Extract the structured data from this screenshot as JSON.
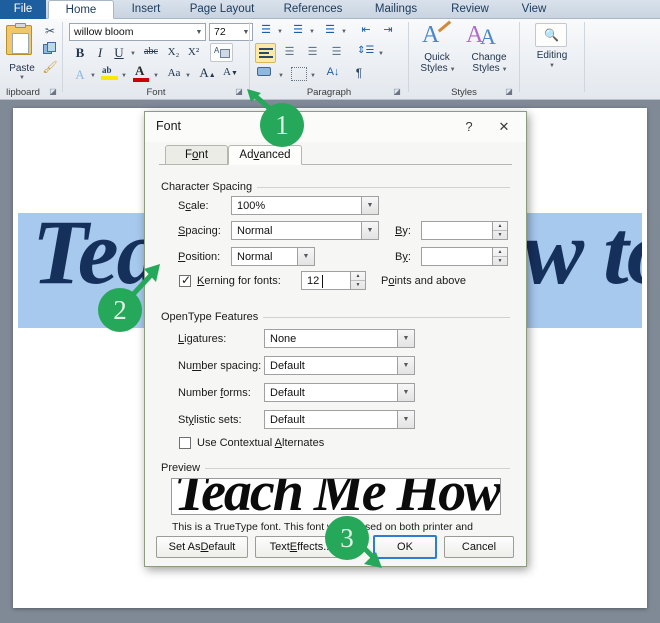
{
  "ribbon": {
    "tabs": [
      {
        "label": "File",
        "name": "tab-file"
      },
      {
        "label": "Home",
        "name": "tab-home"
      },
      {
        "label": "Insert",
        "name": "tab-insert"
      },
      {
        "label": "Page Layout",
        "name": "tab-page-layout"
      },
      {
        "label": "References",
        "name": "tab-references"
      },
      {
        "label": "Mailings",
        "name": "tab-mailings"
      },
      {
        "label": "Review",
        "name": "tab-review"
      },
      {
        "label": "View",
        "name": "tab-view"
      }
    ],
    "groups": {
      "clipboard": "lipboard",
      "font": "Font",
      "paragraph": "Paragraph",
      "styles": "Styles"
    },
    "paste_label": "Paste",
    "font_name": "willow bloom",
    "font_size": "72",
    "quick_styles": [
      "Quick",
      "Styles"
    ],
    "change_styles": [
      "Change",
      "Styles"
    ],
    "editing_label": "Editing",
    "buttons": {
      "bold": "B",
      "italic": "I",
      "underline": "U",
      "strike": "abc",
      "subscript": "X",
      "superscript": "X",
      "pilcrow": "¶"
    }
  },
  "document": {
    "text": "Teach Me How to Love"
  },
  "dialog": {
    "title": "Font",
    "help_glyph": "?",
    "close_glyph": "✕",
    "tabs": [
      {
        "label": "Font",
        "selected": false
      },
      {
        "label": "Advanced",
        "selected": true
      }
    ],
    "character_spacing": {
      "section_title": "Character Spacing",
      "scale_label": "Scale:",
      "scale_value": "100%",
      "spacing_label": "Spacing:",
      "spacing_value": "Normal",
      "spacing_by_label": "By:",
      "spacing_by_value": "",
      "position_label": "Position:",
      "position_value": "Normal",
      "position_by_label": "By:",
      "position_by_value": "",
      "kerning_label": "Kerning for fonts:",
      "kerning_checked": true,
      "kerning_value": "12",
      "kerning_suffix": "Points and above"
    },
    "opentype": {
      "section_title": "OpenType Features",
      "ligatures_label": "Ligatures:",
      "ligatures_value": "None",
      "number_spacing_label": "Number spacing:",
      "number_spacing_value": "Default",
      "number_forms_label": "Number forms:",
      "number_forms_value": "Default",
      "stylistic_sets_label": "Stylistic sets:",
      "stylistic_sets_value": "Default",
      "contextual_label": "Use Contextual Alternates",
      "contextual_checked": false
    },
    "preview": {
      "section_title": "Preview",
      "sample_text": "Teach Me How",
      "note": "This is a TrueType font. This font will be used on both printer and screen."
    },
    "buttons": {
      "set_as_default": "Set As Default",
      "text_effects": "Text Effects...",
      "ok": "OK",
      "cancel": "Cancel"
    }
  },
  "annotations": {
    "badge1": "1",
    "badge2": "2",
    "badge3": "3",
    "badge_color": "#26a85a"
  },
  "colors": {
    "ribbon_tab_active": "#1d5f9e",
    "highlight_blue": "#a7c9ee",
    "doc_text_navy": "#16305c",
    "dialog_border": "#8d9c7e",
    "focus_blue": "#2d7dd2"
  }
}
